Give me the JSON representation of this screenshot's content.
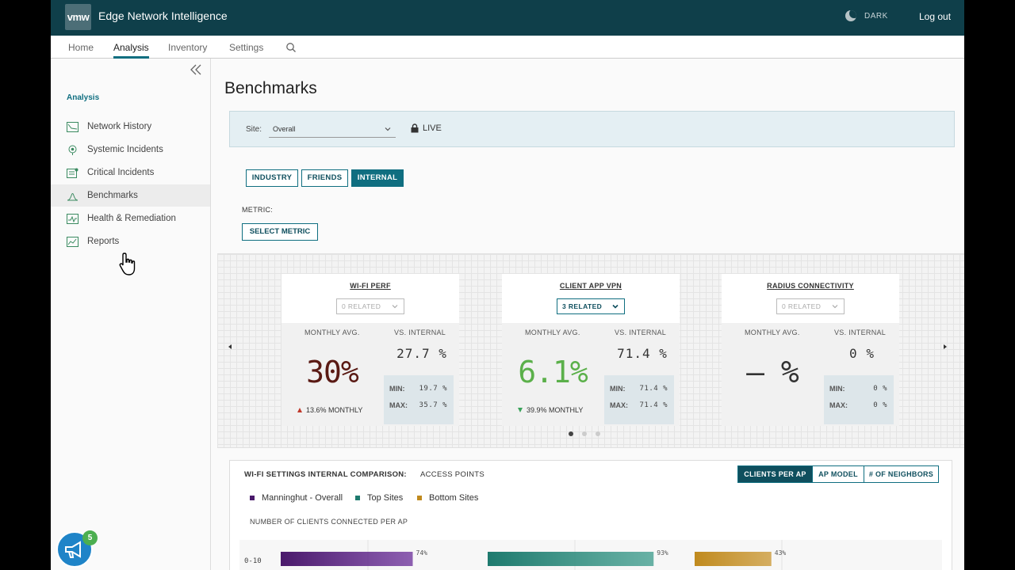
{
  "header": {
    "logo": "vmw",
    "title": "Edge Network Intelligence",
    "dark_label": "DARK",
    "logout": "Log out"
  },
  "nav": {
    "tabs": [
      {
        "label": "Home"
      },
      {
        "label": "Analysis"
      },
      {
        "label": "Inventory"
      },
      {
        "label": "Settings"
      }
    ],
    "active": "Analysis"
  },
  "sidebar": {
    "header": "Analysis",
    "items": [
      {
        "label": "Network History",
        "icon": "network-history-icon"
      },
      {
        "label": "Systemic Incidents",
        "icon": "systemic-incidents-icon"
      },
      {
        "label": "Critical Incidents",
        "icon": "critical-incidents-icon"
      },
      {
        "label": "Benchmarks",
        "icon": "benchmarks-icon"
      },
      {
        "label": "Health & Remediation",
        "icon": "health-remediation-icon"
      },
      {
        "label": "Reports",
        "icon": "reports-icon"
      }
    ],
    "active": "Benchmarks"
  },
  "page": {
    "title": "Benchmarks",
    "site_label": "Site:",
    "site_value": "Overall",
    "live_label": "LIVE",
    "benchmark_tabs": [
      "INDUSTRY",
      "FRIENDS",
      "INTERNAL"
    ],
    "benchmark_active": "INTERNAL",
    "metric_label": "METRIC:",
    "select_metric": "SELECT METRIC"
  },
  "cards": [
    {
      "title": "WI-FI PERF",
      "related": "0 RELATED",
      "monthly_avg_label": "MONTHLY AVG.",
      "vs_label": "VS. INTERNAL",
      "big_value": "30%",
      "big_color": "#5a1a14",
      "trend": "up",
      "trend_text": "13.6% MONTHLY",
      "vs_value": "27.7 %",
      "min_label": "MIN:",
      "min": "19.7 %",
      "max_label": "MAX:",
      "max": "35.7 %"
    },
    {
      "title": "CLIENT APP VPN",
      "related": "3 RELATED",
      "monthly_avg_label": "MONTHLY AVG.",
      "vs_label": "VS. INTERNAL",
      "big_value": "6.1%",
      "big_color": "#5bb04a",
      "trend": "down",
      "trend_text": "39.9% MONTHLY",
      "vs_value": "71.4 %",
      "min_label": "MIN:",
      "min": "71.4 %",
      "max_label": "MAX:",
      "max": "71.4 %"
    },
    {
      "title": "RADIUS CONNECTIVITY",
      "related": "0 RELATED",
      "monthly_avg_label": "MONTHLY AVG.",
      "vs_label": "VS. INTERNAL",
      "big_value": "– %",
      "big_color": "#333333",
      "trend": "none",
      "trend_text": "",
      "vs_value": "0 %",
      "min_label": "MIN:",
      "min": "0 %",
      "max_label": "MAX:",
      "max": "0 %"
    }
  ],
  "comparison": {
    "title": "WI-FI SETTINGS INTERNAL COMPARISON:",
    "subtitle": "ACCESS POINTS",
    "tabs": [
      "CLIENTS PER AP",
      "AP MODEL",
      "# OF NEIGHBORS"
    ],
    "active_tab": "CLIENTS PER AP",
    "legend": [
      {
        "name": "Manninghut - Overall",
        "color": "#4a1a6b"
      },
      {
        "name": "Top Sites",
        "color": "#1e7a6e"
      },
      {
        "name": "Bottom Sites",
        "color": "#c08a1e"
      }
    ],
    "axis_title": "NUMBER OF CLIENTS CONNECTED PER AP"
  },
  "chart_data": {
    "type": "bar",
    "categories": [
      "0-10"
    ],
    "series": [
      {
        "name": "Manninghut - Overall",
        "values": [
          74
        ],
        "color": "#6a2d99"
      },
      {
        "name": "Top Sites",
        "values": [
          93
        ],
        "color": "#3a9a8a"
      },
      {
        "name": "Bottom Sites",
        "values": [
          43
        ],
        "color": "#c9952f"
      }
    ],
    "value_labels": [
      "74%",
      "93%",
      "43%"
    ]
  },
  "notifications": {
    "count": "5"
  }
}
